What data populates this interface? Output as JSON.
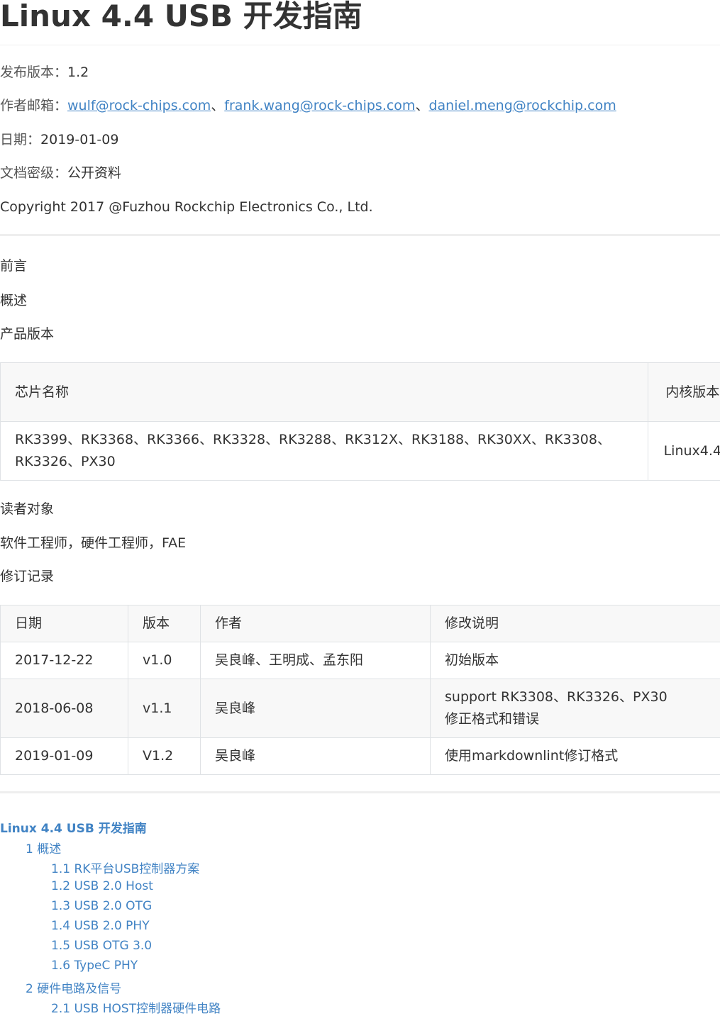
{
  "title": "Linux 4.4 USB 开发指南",
  "meta": {
    "version_label": "发布版本：",
    "version": "1.2",
    "author_label": "作者邮箱：",
    "emails": [
      "wulf@rock-chips.com",
      "frank.wang@rock-chips.com",
      "daniel.meng@rockchip.com"
    ],
    "separator": "、",
    "date_label": "日期：",
    "date": "2019-01-09",
    "security_label": "文档密级：",
    "security": "公开资料",
    "copyright": "Copyright 2017 @Fuzhou Rockchip Electronics Co., Ltd."
  },
  "sections": {
    "preface": "前言",
    "overview": "概述",
    "product_version": "产品版本",
    "audience": "读者对象",
    "audience_text": "软件工程师，硬件工程师，FAE",
    "revision": "修订记录"
  },
  "product_table": {
    "headers": [
      "芯片名称",
      "内核版本"
    ],
    "chips_line1": "RK3399、RK3368、RK3366、RK3328、RK3288、RK312X、RK3188、RK30XX、RK3308、",
    "chips_line2": "RK3326、PX30",
    "kernel": "Linux4.4"
  },
  "revision_table": {
    "headers": [
      "日期",
      "版本",
      "作者",
      "修改说明"
    ],
    "rows": [
      {
        "date": "2017-12-22",
        "version": "v1.0",
        "author": "吴良峰、王明成、孟东阳",
        "desc1": "初始版本",
        "desc2": ""
      },
      {
        "date": "2018-06-08",
        "version": "v1.1",
        "author": "吴良峰",
        "desc1": "support RK3308、RK3326、PX30",
        "desc2": "修正格式和错误"
      },
      {
        "date": "2019-01-09",
        "version": "V1.2",
        "author": "吴良峰",
        "desc1": "使用markdownlint修订格式",
        "desc2": ""
      }
    ]
  },
  "toc": {
    "title": "Linux 4.4 USB 开发指南",
    "items": [
      "1 概述",
      "1.1 RK平台USB控制器方案",
      "1.2 USB 2.0 Host",
      "1.3 USB 2.0 OTG",
      "1.4 USB 2.0 PHY",
      "1.5 USB OTG 3.0",
      "1.6 TypeC PHY",
      "2 硬件电路及信号",
      "2.1 USB HOST控制器硬件电路"
    ]
  },
  "colors": {
    "link": "#4183c4",
    "text": "#333333",
    "table_header_bg": "#f8f8f8",
    "border": "#dfe2e5"
  }
}
